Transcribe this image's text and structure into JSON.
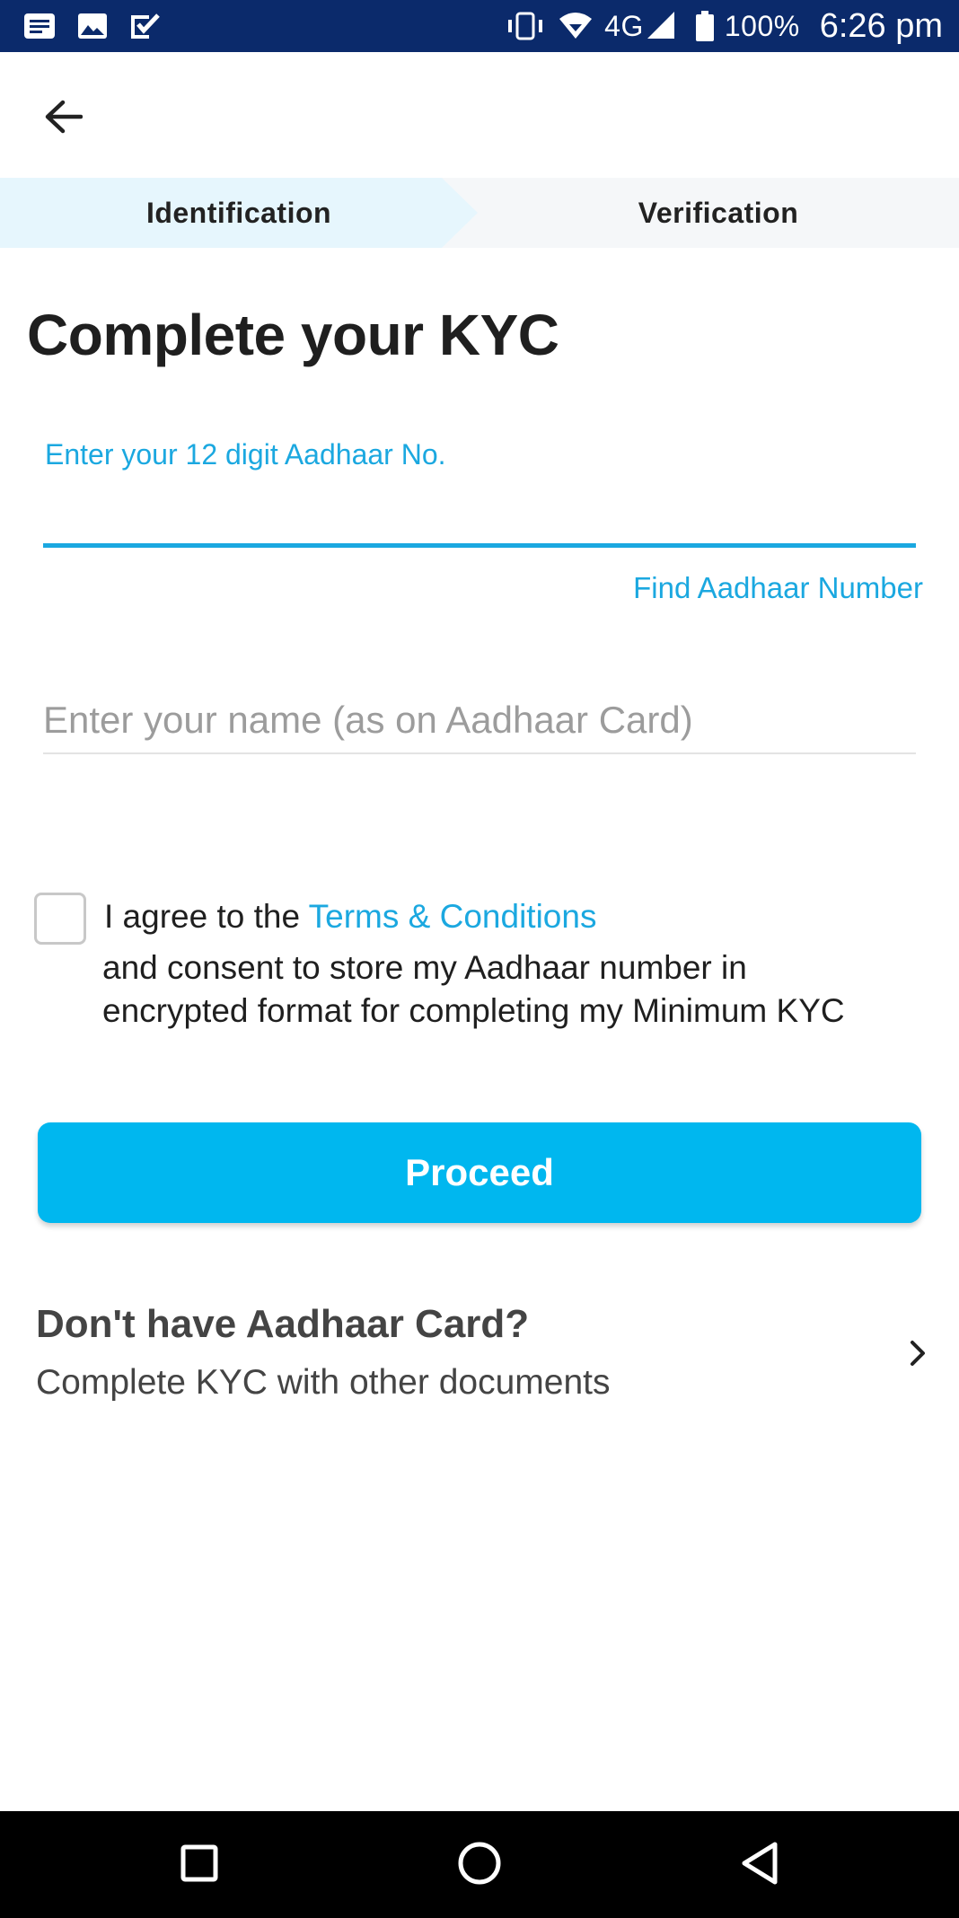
{
  "status_bar": {
    "network": "4G",
    "battery": "100%",
    "time": "6:26 pm",
    "icons": [
      "message-icon",
      "image-icon",
      "task-icon",
      "vibrate-icon",
      "wifi-icon",
      "signal-icon",
      "battery-icon"
    ]
  },
  "header": {
    "back_icon": "arrow-left-icon"
  },
  "steps": [
    {
      "label": "Identification",
      "active": true
    },
    {
      "label": "Verification",
      "active": false
    }
  ],
  "page": {
    "title": "Complete your KYC"
  },
  "aadhaar": {
    "label": "Enter your 12 digit Aadhaar No.",
    "value": "",
    "find_link": "Find Aadhaar Number"
  },
  "name_field": {
    "placeholder": "Enter your name (as on Aadhaar Card)",
    "value": ""
  },
  "consent": {
    "checked": false,
    "prefix": "I agree to the ",
    "terms_link": "Terms & Conditions",
    "line2": "and consent to store my Aadhaar number in",
    "line3": "encrypted format for completing my Minimum KYC"
  },
  "proceed": {
    "label": "Proceed"
  },
  "alt_kyc": {
    "title": "Don't have Aadhaar Card?",
    "subtitle": "Complete KYC with other documents"
  },
  "colors": {
    "accent": "#1ba8e0",
    "button": "#00b7ef",
    "status_bar": "#0b2a6b",
    "step_active_bg": "#e6f6fd"
  },
  "nav_bar": {
    "buttons": [
      "recents-square-icon",
      "home-circle-icon",
      "back-triangle-icon"
    ]
  }
}
